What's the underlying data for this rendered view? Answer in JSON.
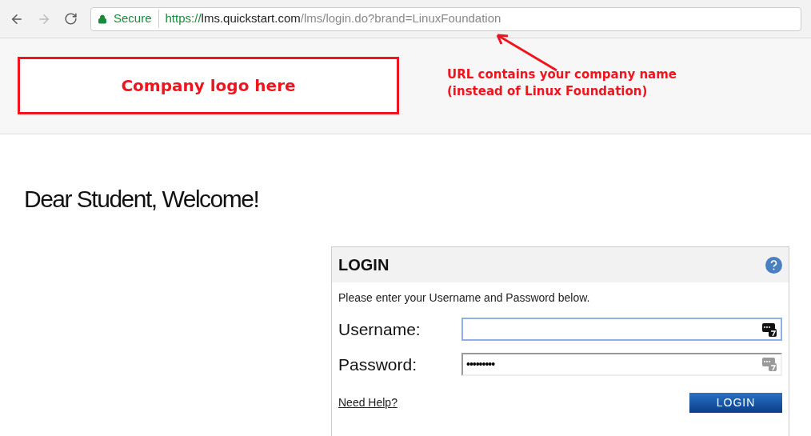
{
  "browser": {
    "secure_label": "Secure",
    "url": {
      "scheme": "https://",
      "host": "lms.quickstart.com",
      "path": "/lms/login.do?brand=LinuxFoundation"
    }
  },
  "header": {
    "logo_placeholder": "Company logo here",
    "annotation": [
      "URL contains your company name",
      "(instead of Linux Foundation)"
    ]
  },
  "greeting": "Dear Student, Welcome!",
  "login": {
    "title": "LOGIN",
    "instructions": "Please enter your Username and Password below.",
    "fields": [
      {
        "label": "Username:",
        "focused": true
      },
      {
        "label": "Password:",
        "value": "•••••••••",
        "focused": false
      }
    ],
    "help_link": "Need Help?",
    "button": "LOGIN"
  }
}
